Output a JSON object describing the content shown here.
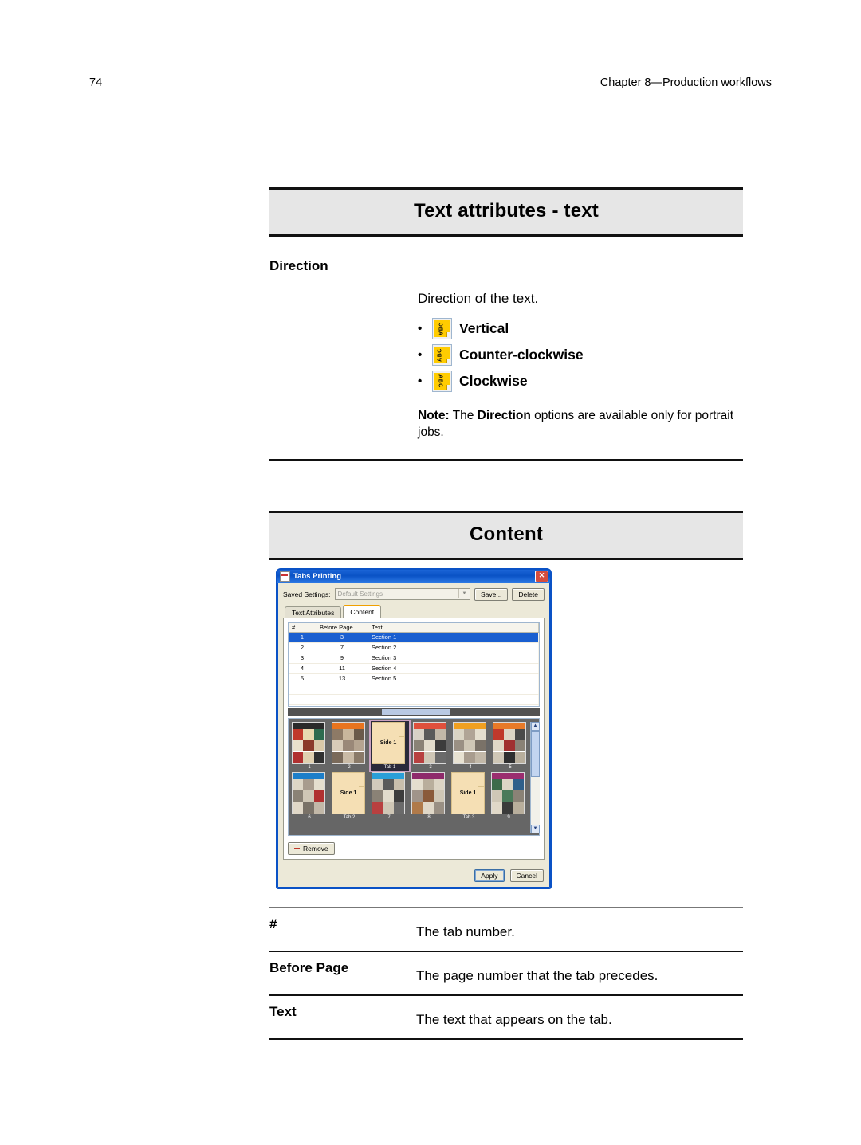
{
  "page_header": {
    "page_number": "74",
    "chapter": "Chapter 8—Production workflows"
  },
  "sections": [
    {
      "title": "Text attributes - text",
      "subhead": "Direction",
      "intro": "Direction of the text.",
      "options": [
        {
          "label": "Vertical",
          "icon": "tab-text-vertical-icon",
          "glyph": "ABC"
        },
        {
          "label": "Counter-clockwise",
          "icon": "tab-text-counter-clockwise-icon",
          "glyph": "ABC"
        },
        {
          "label": "Clockwise",
          "icon": "tab-text-clockwise-icon",
          "glyph": "ABC"
        }
      ],
      "note": {
        "label": "Note:",
        "lead": " The ",
        "term": "Direction",
        "rest": " options are available only for portrait jobs."
      }
    },
    {
      "title": "Content"
    }
  ],
  "dialog": {
    "title": "Tabs Printing",
    "close_label": "✕",
    "saved_settings": {
      "label": "Saved Settings:",
      "value": "Default Settings",
      "save_button": "Save...",
      "delete_button": "Delete"
    },
    "tabs": [
      {
        "label": "Text Attributes",
        "active": false
      },
      {
        "label": "Content",
        "active": true
      }
    ],
    "grid": {
      "columns": [
        "#",
        "Before Page",
        "Text"
      ],
      "rows": [
        {
          "num": "1",
          "before_page": "3",
          "text": "Section 1",
          "selected": true
        },
        {
          "num": "2",
          "before_page": "7",
          "text": "Section 2",
          "selected": false
        },
        {
          "num": "3",
          "before_page": "9",
          "text": "Section 3",
          "selected": false
        },
        {
          "num": "4",
          "before_page": "11",
          "text": "Section 4",
          "selected": false
        },
        {
          "num": "5",
          "before_page": "13",
          "text": "Section 5",
          "selected": false
        }
      ]
    },
    "preview": {
      "row1": [
        {
          "caption": "1",
          "type": "page"
        },
        {
          "caption": "2",
          "type": "page"
        },
        {
          "caption": "Tab 1",
          "type": "tab",
          "side": "Side 1",
          "selected": true
        },
        {
          "caption": "3",
          "type": "page"
        },
        {
          "caption": "4",
          "type": "page"
        },
        {
          "caption": "5",
          "type": "page"
        }
      ],
      "row2": [
        {
          "caption": "6",
          "type": "page"
        },
        {
          "caption": "Tab 2",
          "type": "tab",
          "side": "Side 1"
        },
        {
          "caption": "7",
          "type": "page"
        },
        {
          "caption": "8",
          "type": "page"
        },
        {
          "caption": "Tab 3",
          "type": "tab",
          "side": "Side 1"
        },
        {
          "caption": "9",
          "type": "page"
        }
      ]
    },
    "remove_button": "Remove",
    "apply_button": "Apply",
    "cancel_button": "Cancel"
  },
  "definitions": [
    {
      "term": "#",
      "description": "The tab number."
    },
    {
      "term": "Before Page",
      "description": "The page number that the tab precedes."
    },
    {
      "term": "Text",
      "description": "The text that appears on the tab."
    }
  ],
  "colors": {
    "band": "#e6e6e6",
    "tab_yellow": "#ffcc00",
    "selection_blue": "#1a5fd0",
    "title_blue": "#0a52c6",
    "tab_paper": "#f5dfb4"
  }
}
